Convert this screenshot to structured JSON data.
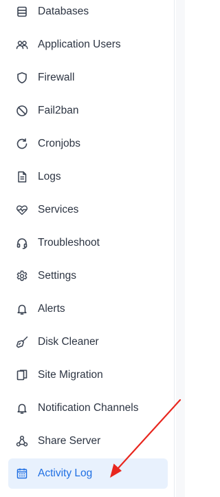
{
  "sidebar": {
    "items": [
      {
        "label": "Databases",
        "icon": "database-icon",
        "active": false
      },
      {
        "label": "Application Users",
        "icon": "users-icon",
        "active": false
      },
      {
        "label": "Firewall",
        "icon": "shield-icon",
        "active": false
      },
      {
        "label": "Fail2ban",
        "icon": "ban-icon",
        "active": false
      },
      {
        "label": "Cronjobs",
        "icon": "refresh-icon",
        "active": false
      },
      {
        "label": "Logs",
        "icon": "file-text-icon",
        "active": false
      },
      {
        "label": "Services",
        "icon": "heart-pulse-icon",
        "active": false
      },
      {
        "label": "Troubleshoot",
        "icon": "headphones-icon",
        "active": false
      },
      {
        "label": "Settings",
        "icon": "gear-icon",
        "active": false
      },
      {
        "label": "Alerts",
        "icon": "bell-icon",
        "active": false
      },
      {
        "label": "Disk Cleaner",
        "icon": "broom-icon",
        "active": false
      },
      {
        "label": "Site Migration",
        "icon": "copy-icon",
        "active": false
      },
      {
        "label": "Notification Channels",
        "icon": "bell-icon",
        "active": false
      },
      {
        "label": "Share Server",
        "icon": "share-icon",
        "active": false
      },
      {
        "label": "Activity Log",
        "icon": "calendar-icon",
        "active": true
      }
    ]
  },
  "colors": {
    "text": "#2c3442",
    "icon": "#3a4352",
    "active_bg": "#e8f1fd",
    "active_text": "#1f6fe3",
    "annotation_arrow": "#e8261e"
  }
}
